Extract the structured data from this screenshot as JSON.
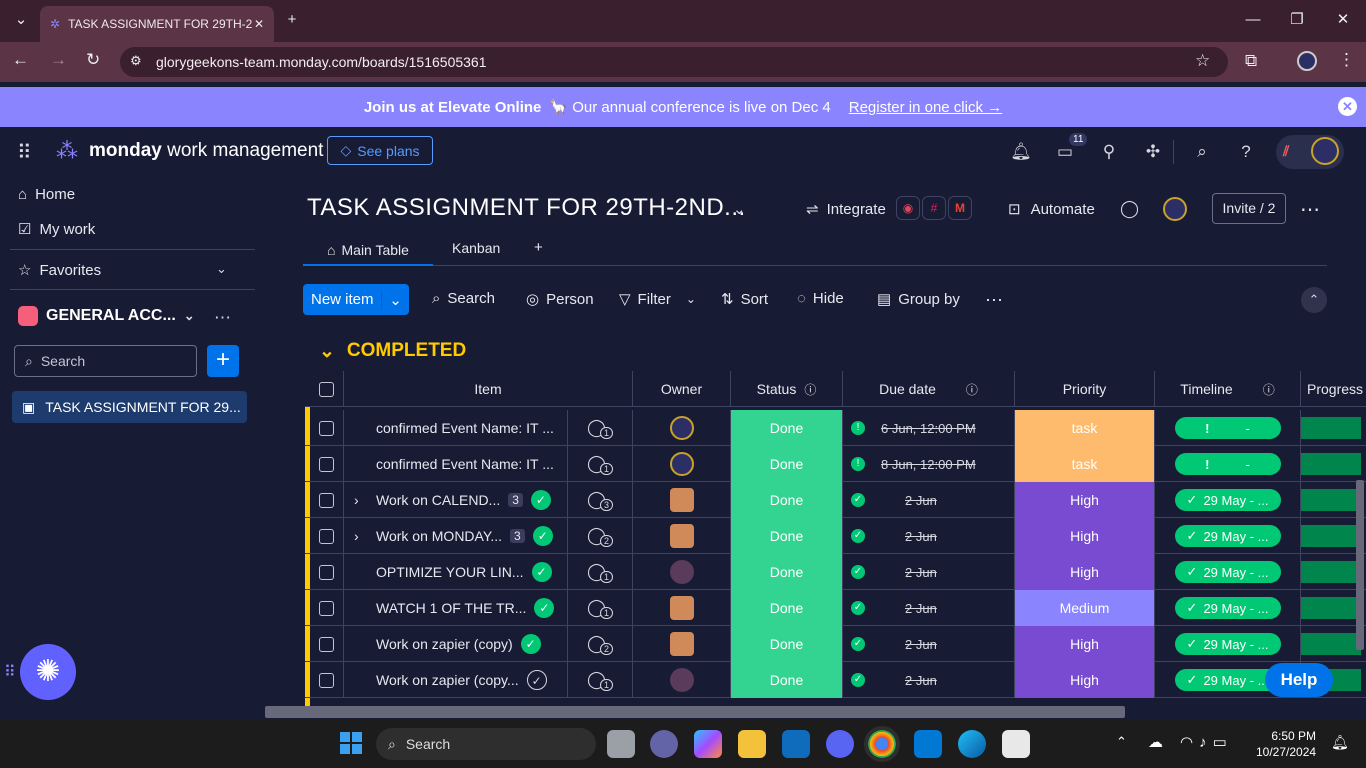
{
  "browser": {
    "tab_title": "TASK ASSIGNMENT FOR 29TH-2",
    "url": "glorygeekons-team.monday.com/boards/1516505361",
    "new_tab": "+"
  },
  "banner": {
    "bold": "Join us at Elevate Online",
    "text": "🦙 Our annual conference is live on Dec 4",
    "link": "Register in one click →"
  },
  "header": {
    "brand": "monday",
    "product": "work management",
    "see_plans": "See plans",
    "inbox_count": "11"
  },
  "sidebar": {
    "home": "Home",
    "my_work": "My work",
    "favorites": "Favorites",
    "workspace": "GENERAL ACC...",
    "search_placeholder": "Search",
    "board": "TASK ASSIGNMENT FOR 29..."
  },
  "board": {
    "title": "TASK ASSIGNMENT FOR 29TH-2ND...",
    "integrate": "Integrate",
    "automate": "Automate",
    "invite": "Invite / 2",
    "tabs": [
      "Main Table",
      "Kanban"
    ],
    "new_item": "New item",
    "tools": [
      "Search",
      "Person",
      "Filter",
      "Sort",
      "Hide",
      "Group by"
    ],
    "group": "COMPLETED",
    "columns": [
      "Item",
      "Owner",
      "Status",
      "Due date",
      "Priority",
      "Timeline",
      "Progress"
    ],
    "rows": [
      {
        "item": "confirmed Event Name: IT ...",
        "subitems": "",
        "updates": "1",
        "status": "Done",
        "due": "6 Jun, 12:00 PM",
        "due_alert": true,
        "priority": "task",
        "timeline": "-",
        "tl_alert": true,
        "avatar": "b"
      },
      {
        "item": "confirmed Event Name: IT ...",
        "subitems": "",
        "updates": "1",
        "status": "Done",
        "due": "8 Jun, 12:00 PM",
        "due_alert": true,
        "priority": "task",
        "timeline": "-",
        "tl_alert": true,
        "avatar": "b"
      },
      {
        "item": "Work on CALEND...",
        "subitems": "3",
        "updates": "3",
        "status": "Done",
        "due": "2 Jun",
        "due_alert": false,
        "priority": "High",
        "timeline": "29 May - ...",
        "tl_alert": false,
        "avatar": "a"
      },
      {
        "item": "Work on MONDAY...",
        "subitems": "3",
        "updates": "2",
        "status": "Done",
        "due": "2 Jun",
        "due_alert": false,
        "priority": "High",
        "timeline": "29 May - ...",
        "tl_alert": false,
        "avatar": "a"
      },
      {
        "item": "OPTIMIZE YOUR LIN...",
        "subitems": "",
        "updates": "1",
        "status": "Done",
        "due": "2 Jun",
        "due_alert": false,
        "priority": "High",
        "timeline": "29 May - ...",
        "tl_alert": false,
        "avatar": "c"
      },
      {
        "item": "WATCH 1 OF THE TR...",
        "subitems": "",
        "updates": "1",
        "status": "Done",
        "due": "2 Jun",
        "due_alert": false,
        "priority": "Medium",
        "timeline": "29 May - ...",
        "tl_alert": false,
        "avatar": "a"
      },
      {
        "item": "Work on zapier (copy)",
        "subitems": "",
        "updates": "2",
        "status": "Done",
        "due": "2 Jun",
        "due_alert": false,
        "priority": "High",
        "timeline": "29 May - ...",
        "tl_alert": false,
        "avatar": "a"
      },
      {
        "item": "Work on zapier (copy...",
        "subitems": "",
        "updates": "1",
        "status": "Done",
        "due": "2 Jun",
        "due_alert": false,
        "priority": "High",
        "timeline": "29 May - ...",
        "tl_alert": false,
        "avatar": "c"
      }
    ],
    "help": "Help"
  },
  "taskbar": {
    "search": "Search",
    "time": "6:50 PM",
    "date": "10/27/2024"
  },
  "colors": {
    "done": "#33d391",
    "high": "#784bd1",
    "medium": "#8a84ff",
    "task": "#ffbb6d",
    "group": "#ffcb00",
    "primary": "#0073ea"
  }
}
